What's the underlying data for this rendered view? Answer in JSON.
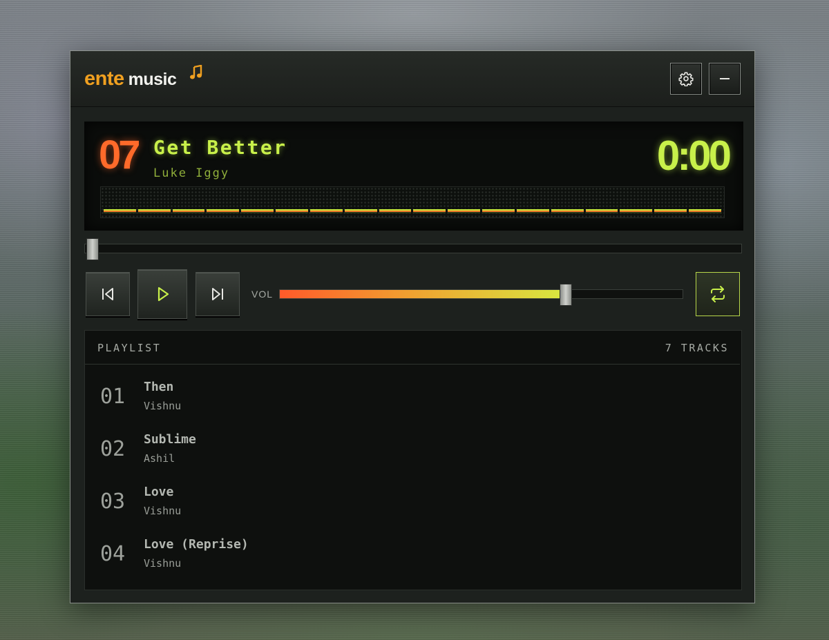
{
  "app": {
    "logo_primary": "ente",
    "logo_secondary": "music"
  },
  "titlebar": {
    "settings_icon": "gear-icon",
    "minimize_icon": "minus-icon"
  },
  "now_playing": {
    "track_number": "07",
    "title": "Get Better",
    "artist": "Luke Iggy",
    "time": "0:00",
    "seek_fraction": 0.0
  },
  "controls": {
    "prev_icon": "skip-previous-icon",
    "play_icon": "play-icon",
    "next_icon": "skip-next-icon",
    "volume_label": "VOL",
    "volume_fraction": 0.71,
    "repeat_icon": "repeat-icon",
    "repeat_active": true
  },
  "playlist": {
    "title": "PLAYLIST",
    "count_label": "7 TRACKS",
    "items": [
      {
        "num": "01",
        "title": "Then",
        "artist": "Vishnu"
      },
      {
        "num": "02",
        "title": "Sublime",
        "artist": "Ashil"
      },
      {
        "num": "03",
        "title": "Love",
        "artist": "Vishnu"
      },
      {
        "num": "04",
        "title": "Love (Reprise)",
        "artist": "Vishnu"
      }
    ]
  },
  "colors": {
    "accent_green": "#c8f04a",
    "accent_orange": "#ff6a2a",
    "logo_orange": "#f0a020"
  }
}
